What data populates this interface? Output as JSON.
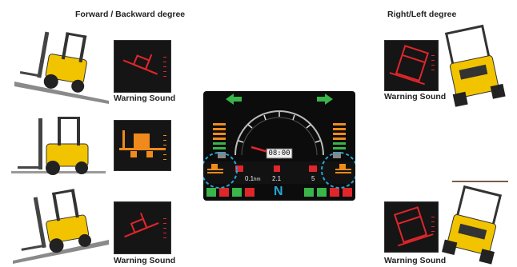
{
  "headings": {
    "forward_backward": "Forward / Backward degree",
    "right_left": "Right/Left degree"
  },
  "warning_label": "Warning Sound",
  "dashboard": {
    "clock": "08:00",
    "readout_left": "0.1",
    "readout_left_unit": "hm",
    "readout_mid": "2.1",
    "readout_right": "5",
    "gear": "N"
  },
  "colors": {
    "alert_red": "#e0252b",
    "ok_orange": "#f08a1c",
    "forklift_yellow": "#f2c400",
    "arrow_green": "#39b54a",
    "highlight_cyan": "#22a8d8"
  },
  "icons": [
    "forklift-forward-tilt-icon",
    "forklift-level-icon",
    "forklift-backward-tilt-icon",
    "forklift-right-tilt-icon",
    "forklift-left-tilt-icon",
    "green-arrow-left-icon",
    "green-arrow-right-icon"
  ]
}
